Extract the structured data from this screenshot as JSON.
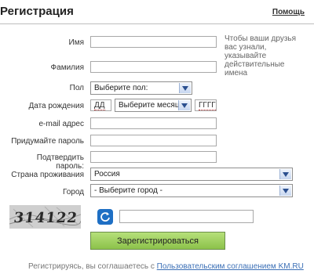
{
  "header": {
    "title": "Регистрация",
    "help_link": "Помощь"
  },
  "form": {
    "first_name_label": "Имя",
    "last_name_label": "Фамилия",
    "hint": "Чтобы ваши друзья вас узнали, указывайте действительные имена",
    "gender_label": "Пол",
    "gender_select": "Выберите пол:",
    "birthdate_label": "Дата рождения",
    "day_placeholder": "ДД",
    "month_select": "Выберите месяц:",
    "year_placeholder": "ГГГГ",
    "email_label": "e-mail адрес",
    "password_label": "Придумайте пароль",
    "confirm_label": "Подтвердить пароль:",
    "country_label": "Страна проживания",
    "country_select": "Россия",
    "city_label": "Город",
    "city_select": "- Выберите город -",
    "captcha_text": "314122",
    "submit": "Зарегистрироваться",
    "terms_prefix": "Регистрируясь, вы соглашаетесь с",
    "terms_link": "Пользовательским соглашением KM.RU"
  },
  "colors": {
    "submit_green": "#8cc24a",
    "refresh_blue": "#1e6fc4",
    "link_blue": "#3b6fb6"
  }
}
